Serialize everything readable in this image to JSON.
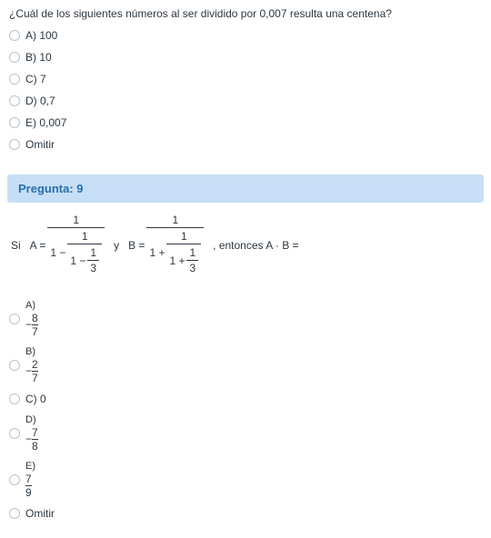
{
  "q8": {
    "text": "¿Cuál de los siguientes números al ser dividido por 0,007 resulta una centena?",
    "options": {
      "a": "A) 100",
      "b": "B) 10",
      "c": "C) 7",
      "d": "D) 0,7",
      "e": "E) 0,007",
      "skip": "Omitir"
    }
  },
  "q9": {
    "header": "Pregunta: 9",
    "stem": {
      "si": "Si",
      "a_eq": "A =",
      "y": "y",
      "b_eq": "B =",
      "entonces": ", entonces A · B =",
      "one": "1",
      "one_minus": "1 −",
      "one_plus": "1 +",
      "three": "3"
    },
    "options": {
      "a_letter": "A)",
      "a_num": "8",
      "a_den": "7",
      "b_letter": "B)",
      "b_num": "2",
      "b_den": "7",
      "c": "C) 0",
      "d_letter": "D)",
      "d_num": "7",
      "d_den": "8",
      "e_letter": "E)",
      "e_num": "7",
      "e_den": "9",
      "skip": "Omitir",
      "neg": "−"
    }
  }
}
